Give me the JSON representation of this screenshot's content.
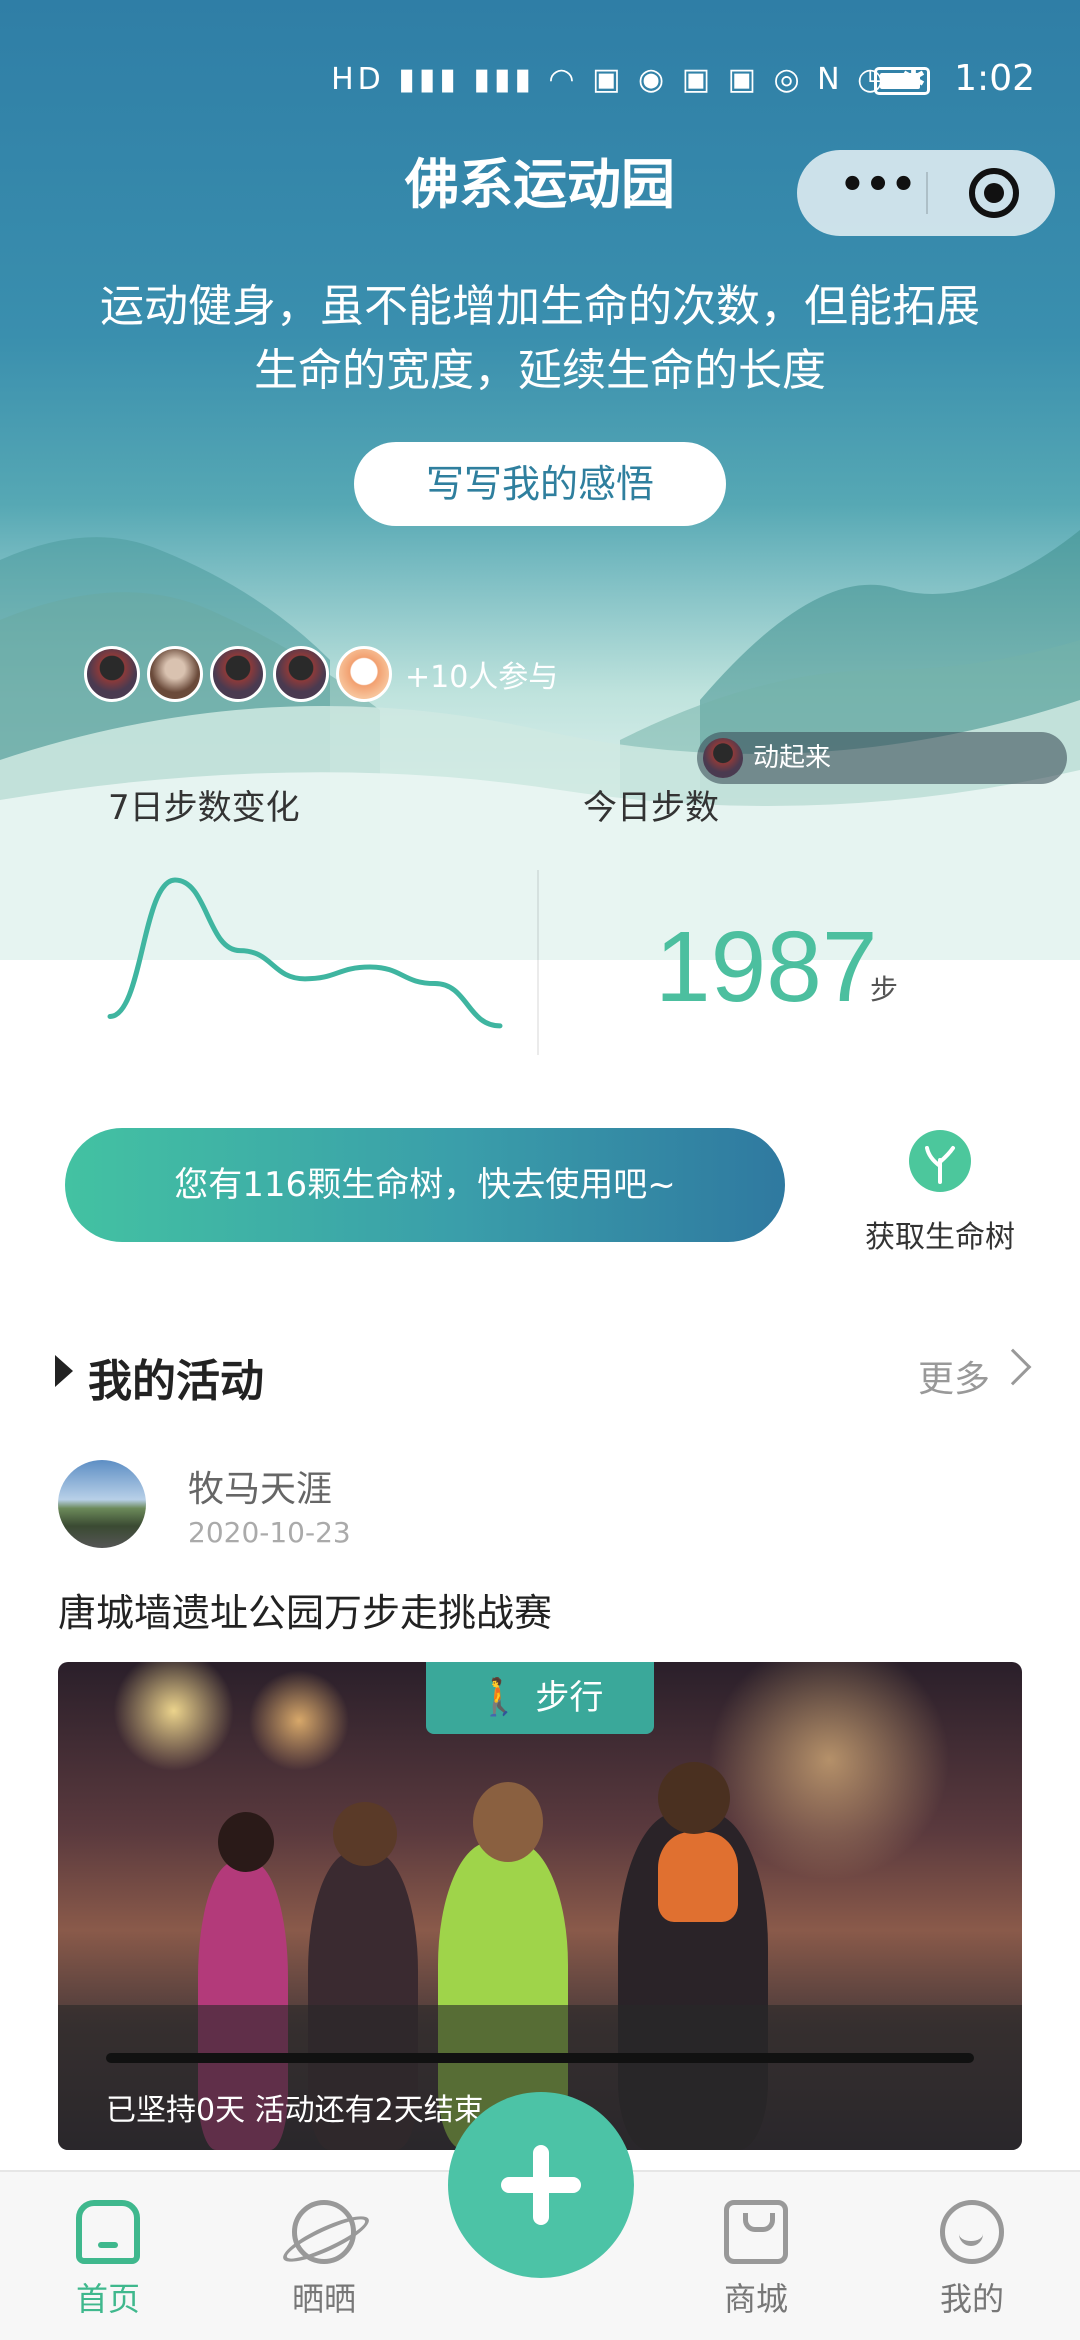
{
  "status_bar": {
    "time": "1:02",
    "icons": [
      "hd-icon",
      "signal-5g-icon",
      "signal-4g-icon",
      "wifi-icon",
      "book-icon",
      "qq-icon",
      "app-icon",
      "app-icon-2",
      "eye-icon",
      "nfc-icon",
      "alarm-icon",
      "bluetooth-icon",
      "battery-icon"
    ]
  },
  "header": {
    "title": "佛系运动园",
    "menu_icon": "more-dots-icon",
    "close_icon": "target-icon"
  },
  "hero": {
    "motto_line1": "运动健身，虽不能增加生命的次数，但能拓展",
    "motto_line2": "生命的宽度，延续生命的长度",
    "write_button": "写写我的感悟",
    "participants": "+10人参与",
    "toast": "动起来"
  },
  "stats": {
    "week_label": "7日步数变化",
    "today_label": "今日步数",
    "today_steps": "1987",
    "steps_unit": "步"
  },
  "chart_data": {
    "type": "line",
    "x": [
      1,
      2,
      3,
      4,
      5,
      6,
      7
    ],
    "values": [
      500,
      3400,
      1900,
      1300,
      1550,
      1200,
      300
    ],
    "title": "",
    "xlabel": "",
    "ylabel": "",
    "color": "#3fb5a0",
    "grid": false
  },
  "tree": {
    "banner": "您有116颗生命树，快去使用吧~",
    "get_label": "获取生命树"
  },
  "activities": {
    "section_title": "我的活动",
    "more": "更多",
    "user_name": "牧马天涯",
    "date": "2020-10-23",
    "title": "唐城墙遗址公园万步走挑战赛",
    "tag": "步行",
    "status": "已坚持0天 活动还有2天结束",
    "progress": 0
  },
  "tabbar": {
    "home": "首页",
    "share": "晒晒",
    "mall": "商城",
    "mine": "我的",
    "active": "home",
    "active_color": "#3fb88d"
  }
}
